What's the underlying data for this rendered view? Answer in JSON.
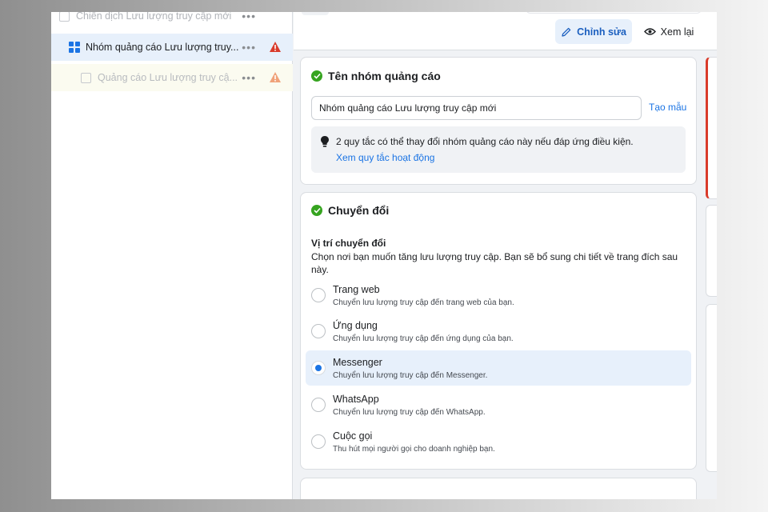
{
  "tree": {
    "campaign": {
      "label": "Chiến dịch Lưu lượng truy cập mới",
      "more": "•••"
    },
    "adset": {
      "label": "Nhóm quảng cáo Lưu lượng truy...",
      "more": "•••"
    },
    "ad": {
      "label": "Quảng cáo Lưu lượng truy cậ...",
      "more": "•••"
    }
  },
  "toolbar": {
    "edit_label": "Chỉnh sửa",
    "review_label": "Xem lại"
  },
  "adset_name_card": {
    "title": "Tên nhóm quảng cáo",
    "name_value": "Nhóm quảng cáo Lưu lượng truy cập mới",
    "template_link": "Tạo mẫu",
    "rules_text": "2 quy tắc có thể thay đổi nhóm quảng cáo này nếu đáp ứng điều kiện.",
    "rules_link": "Xem quy tắc hoạt động"
  },
  "conversion_card": {
    "title": "Chuyển đổi",
    "location_label": "Vị trí chuyển đổi",
    "location_desc": "Chọn nơi bạn muốn tăng lưu lượng truy cập. Bạn sẽ bổ sung chi tiết về trang đích sau này.",
    "options": [
      {
        "title": "Trang web",
        "desc": "Chuyển lưu lượng truy cập đến trang web của bạn."
      },
      {
        "title": "Ứng dụng",
        "desc": "Chuyển lưu lượng truy cập đến ứng dụng của bạn."
      },
      {
        "title": "Messenger",
        "desc": "Chuyển lưu lượng truy cập đến Messenger."
      },
      {
        "title": "WhatsApp",
        "desc": "Chuyển lưu lượng truy cập đến WhatsApp."
      },
      {
        "title": "Cuộc gọi",
        "desc": "Thu hút mọi người gọi cho doanh nghiệp bạn."
      }
    ],
    "selected_option": "Messenger"
  },
  "colors": {
    "accent": "#1b74e4",
    "success": "#36a420",
    "error": "#d93b2b",
    "warning": "#f0a27a"
  }
}
